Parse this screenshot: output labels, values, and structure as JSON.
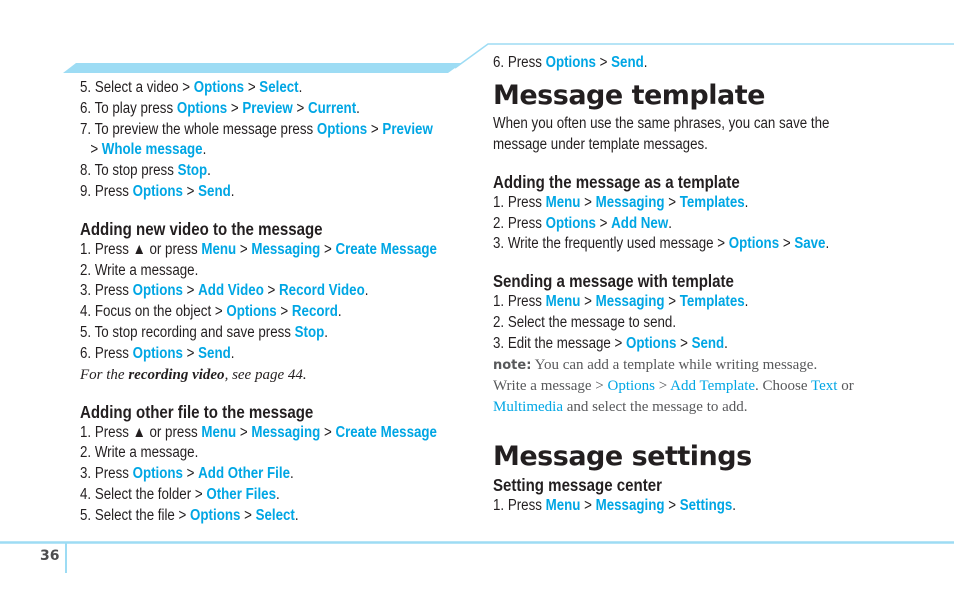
{
  "page": {
    "number": "36",
    "accent_color": "#00a6e4",
    "band_color": "#9ddcf4"
  },
  "left_column": {
    "continued_steps": [
      {
        "parts": [
          {
            "t": "5. Select a video > "
          },
          {
            "t": "Options",
            "h": true
          },
          {
            "t": " > "
          },
          {
            "t": "Select",
            "h": true
          },
          {
            "t": "."
          }
        ]
      },
      {
        "parts": [
          {
            "t": "6. To play press "
          },
          {
            "t": "Options",
            "h": true
          },
          {
            "t": " > "
          },
          {
            "t": "Preview",
            "h": true
          },
          {
            "t": " > "
          },
          {
            "t": "Current",
            "h": true
          },
          {
            "t": "."
          }
        ]
      },
      {
        "parts": [
          {
            "t": "7. To preview the whole message press "
          },
          {
            "t": "Options",
            "h": true
          },
          {
            "t": " > "
          },
          {
            "t": "Preview",
            "h": true
          }
        ]
      },
      {
        "indent": true,
        "parts": [
          {
            "t": "> "
          },
          {
            "t": "Whole message",
            "h": true
          },
          {
            "t": "."
          }
        ]
      },
      {
        "parts": [
          {
            "t": "8. To stop press "
          },
          {
            "t": "Stop",
            "h": true
          },
          {
            "t": "."
          }
        ]
      },
      {
        "parts": [
          {
            "t": "9. Press "
          },
          {
            "t": "Options",
            "h": true
          },
          {
            "t": " > "
          },
          {
            "t": "Send",
            "h": true
          },
          {
            "t": "."
          }
        ]
      }
    ],
    "new_video": {
      "heading": "Adding new video to the message",
      "steps": [
        {
          "parts": [
            {
              "t": "1. Press ▲ or press "
            },
            {
              "t": "Menu",
              "h": true
            },
            {
              "t": " > "
            },
            {
              "t": "Messaging",
              "h": true
            },
            {
              "t": " > "
            },
            {
              "t": "Create Message",
              "h": true
            }
          ]
        },
        {
          "parts": [
            {
              "t": "2. Write a message."
            }
          ]
        },
        {
          "parts": [
            {
              "t": "3. Press "
            },
            {
              "t": "Options",
              "h": true
            },
            {
              "t": " > "
            },
            {
              "t": "Add Video",
              "h": true
            },
            {
              "t": " > "
            },
            {
              "t": "Record Video",
              "h": true
            },
            {
              "t": "."
            }
          ]
        },
        {
          "parts": [
            {
              "t": "4. Focus on the object > "
            },
            {
              "t": "Options",
              "h": true
            },
            {
              "t": " > "
            },
            {
              "t": "Record",
              "h": true
            },
            {
              "t": "."
            }
          ]
        },
        {
          "parts": [
            {
              "t": "5. To stop recording and save press "
            },
            {
              "t": "Stop",
              "h": true
            },
            {
              "t": "."
            }
          ]
        },
        {
          "parts": [
            {
              "t": "6. Press "
            },
            {
              "t": "Options",
              "h": true
            },
            {
              "t": " > "
            },
            {
              "t": "Send",
              "h": true
            },
            {
              "t": "."
            }
          ]
        }
      ],
      "reference": {
        "prefix": "For the ",
        "bold": "recording video",
        "suffix": ", see page 44."
      }
    },
    "other_file": {
      "heading": "Adding other file to the message",
      "steps": [
        {
          "parts": [
            {
              "t": "1. Press ▲ or press "
            },
            {
              "t": "Menu",
              "h": true
            },
            {
              "t": " > "
            },
            {
              "t": "Messaging",
              "h": true
            },
            {
              "t": " > "
            },
            {
              "t": "Create Message",
              "h": true
            }
          ]
        },
        {
          "parts": [
            {
              "t": "2. Write a message."
            }
          ]
        },
        {
          "parts": [
            {
              "t": "3. Press "
            },
            {
              "t": "Options",
              "h": true
            },
            {
              "t": " > "
            },
            {
              "t": "Add Other File",
              "h": true
            },
            {
              "t": "."
            }
          ]
        },
        {
          "parts": [
            {
              "t": "4. Select the folder > "
            },
            {
              "t": "Other Files",
              "h": true
            },
            {
              "t": "."
            }
          ]
        },
        {
          "parts": [
            {
              "t": "5. Select the file > "
            },
            {
              "t": "Options",
              "h": true
            },
            {
              "t": " > "
            },
            {
              "t": "Select",
              "h": true
            },
            {
              "t": "."
            }
          ]
        }
      ]
    }
  },
  "right_column": {
    "continued_steps": [
      {
        "parts": [
          {
            "t": "6. Press "
          },
          {
            "t": "Options",
            "h": true
          },
          {
            "t": " > "
          },
          {
            "t": "Send",
            "h": true
          },
          {
            "t": "."
          }
        ]
      }
    ],
    "message_template": {
      "title": "Message template",
      "intro_line1": "When you often use the same phrases, you can save the",
      "intro_line2": "message under template messages.",
      "adding": {
        "heading": "Adding the message as a template",
        "steps": [
          {
            "parts": [
              {
                "t": "1. Press "
              },
              {
                "t": "Menu",
                "h": true
              },
              {
                "t": " > "
              },
              {
                "t": "Messaging",
                "h": true
              },
              {
                "t": " > "
              },
              {
                "t": "Templates",
                "h": true
              },
              {
                "t": "."
              }
            ]
          },
          {
            "parts": [
              {
                "t": "2. Press "
              },
              {
                "t": "Options",
                "h": true
              },
              {
                "t": " > "
              },
              {
                "t": "Add New",
                "h": true
              },
              {
                "t": "."
              }
            ]
          },
          {
            "parts": [
              {
                "t": "3. Write the frequently used message > "
              },
              {
                "t": "Options",
                "h": true
              },
              {
                "t": " > "
              },
              {
                "t": "Save",
                "h": true
              },
              {
                "t": "."
              }
            ]
          }
        ]
      },
      "sending": {
        "heading": "Sending a message with template",
        "steps": [
          {
            "parts": [
              {
                "t": "1. Press "
              },
              {
                "t": "Menu",
                "h": true
              },
              {
                "t": " > "
              },
              {
                "t": "Messaging",
                "h": true
              },
              {
                "t": " > "
              },
              {
                "t": "Templates",
                "h": true
              },
              {
                "t": "."
              }
            ]
          },
          {
            "parts": [
              {
                "t": "2. Select the message to send."
              }
            ]
          },
          {
            "parts": [
              {
                "t": "3. Edit the message > "
              },
              {
                "t": "Options",
                "h": true
              },
              {
                "t": " > "
              },
              {
                "t": "Send",
                "h": true
              },
              {
                "t": "."
              }
            ]
          }
        ]
      },
      "note": {
        "label": "note:",
        "line1": " You can add a template while writing message.",
        "line2_parts": [
          {
            "t": "Write a message > "
          },
          {
            "t": "Options",
            "h": true
          },
          {
            "t": " > "
          },
          {
            "t": "Add Template",
            "h": true
          },
          {
            "t": ". Choose "
          },
          {
            "t": "Text",
            "h": true
          },
          {
            "t": " or"
          }
        ],
        "line3_parts": [
          {
            "t": "Multimedia",
            "h": true
          },
          {
            "t": " and select the message to add."
          }
        ]
      }
    },
    "message_settings": {
      "title": "Message settings",
      "center": {
        "heading": "Setting message center",
        "steps": [
          {
            "parts": [
              {
                "t": "1. Press "
              },
              {
                "t": "Menu",
                "h": true
              },
              {
                "t": " > "
              },
              {
                "t": "Messaging",
                "h": true
              },
              {
                "t": " > "
              },
              {
                "t": "Settings",
                "h": true
              },
              {
                "t": "."
              }
            ]
          }
        ]
      }
    }
  }
}
